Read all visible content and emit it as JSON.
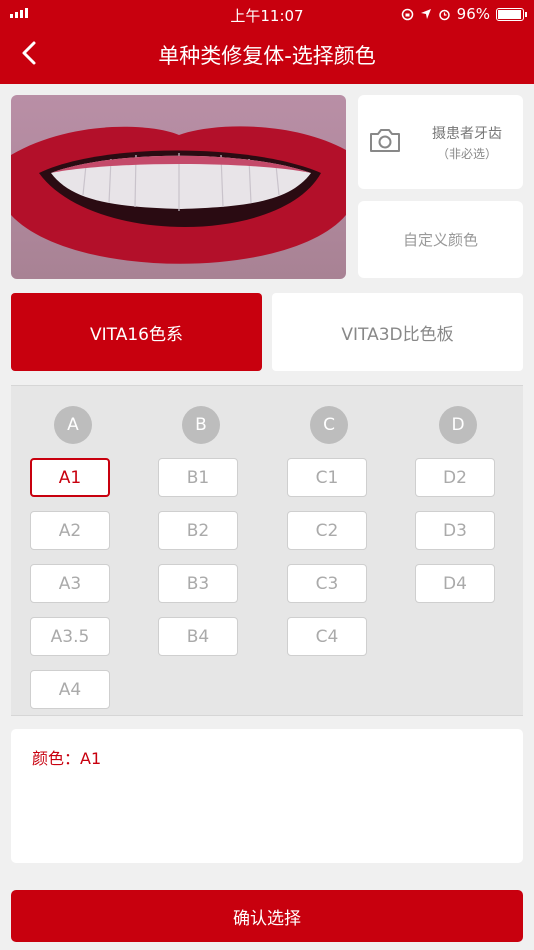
{
  "status_bar": {
    "time": "上午11:07",
    "battery": "96%",
    "battery_level": 0.96
  },
  "header": {
    "title": "单种类修复体-选择颜色",
    "back_icon": "chevron-left-icon"
  },
  "photo": {
    "alt": "teeth-photo"
  },
  "photo_button": {
    "label": "摄患者牙齿",
    "sublabel": "（非必选）",
    "icon": "camera-icon"
  },
  "custom_color_button": {
    "label": "自定义颜色"
  },
  "tabs": [
    {
      "label": "VITA16色系",
      "active": true
    },
    {
      "label": "VITA3D比色板",
      "active": false
    }
  ],
  "shade_columns": [
    {
      "head": "A",
      "shades": [
        "A1",
        "A2",
        "A3",
        "A3.5",
        "A4"
      ]
    },
    {
      "head": "B",
      "shades": [
        "B1",
        "B2",
        "B3",
        "B4"
      ]
    },
    {
      "head": "C",
      "shades": [
        "C1",
        "C2",
        "C3",
        "C4"
      ]
    },
    {
      "head": "D",
      "shades": [
        "D2",
        "D3",
        "D4"
      ]
    }
  ],
  "selected_shade": "A1",
  "result": {
    "text": "颜色：A1"
  },
  "confirm_button": {
    "label": "确认选择"
  },
  "colors": {
    "accent": "#c8000e",
    "background": "#f0f0f0",
    "grid_background": "#e6e6e6"
  }
}
